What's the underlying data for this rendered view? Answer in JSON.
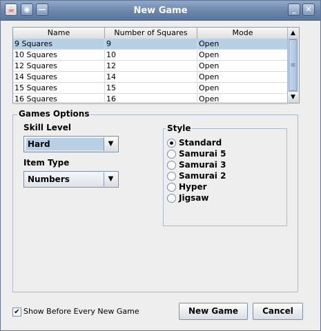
{
  "window": {
    "title": "New Game"
  },
  "table": {
    "columns": [
      "Name",
      "Number of Squares",
      "Mode"
    ],
    "rows": [
      [
        "9 Squares",
        "9",
        "Open"
      ],
      [
        "10 Squares",
        "10",
        "Open"
      ],
      [
        "12 Squares",
        "12",
        "Open"
      ],
      [
        "14 Squares",
        "14",
        "Open"
      ],
      [
        "15 Squares",
        "15",
        "Open"
      ],
      [
        "16 Squares",
        "16",
        "Open"
      ]
    ],
    "selected_row": 0
  },
  "options": {
    "group_title": "Games Options",
    "skill_level_label": "Skill Level",
    "skill_level_value": "Hard",
    "item_type_label": "Item Type",
    "item_type_value": "Numbers",
    "style_title": "Style",
    "styles": [
      "Standard",
      "Samurai 5",
      "Samurai 3",
      "Samurai 2",
      "Hyper",
      "Jigsaw"
    ],
    "selected_style": "Standard"
  },
  "footer": {
    "show_before_label": "Show Before Every New Game",
    "show_before_checked": true,
    "new_game_label": "New Game",
    "cancel_label": "Cancel"
  },
  "colors": {
    "titlebar": "#6a86ad",
    "selection": "#b8cfe5"
  }
}
